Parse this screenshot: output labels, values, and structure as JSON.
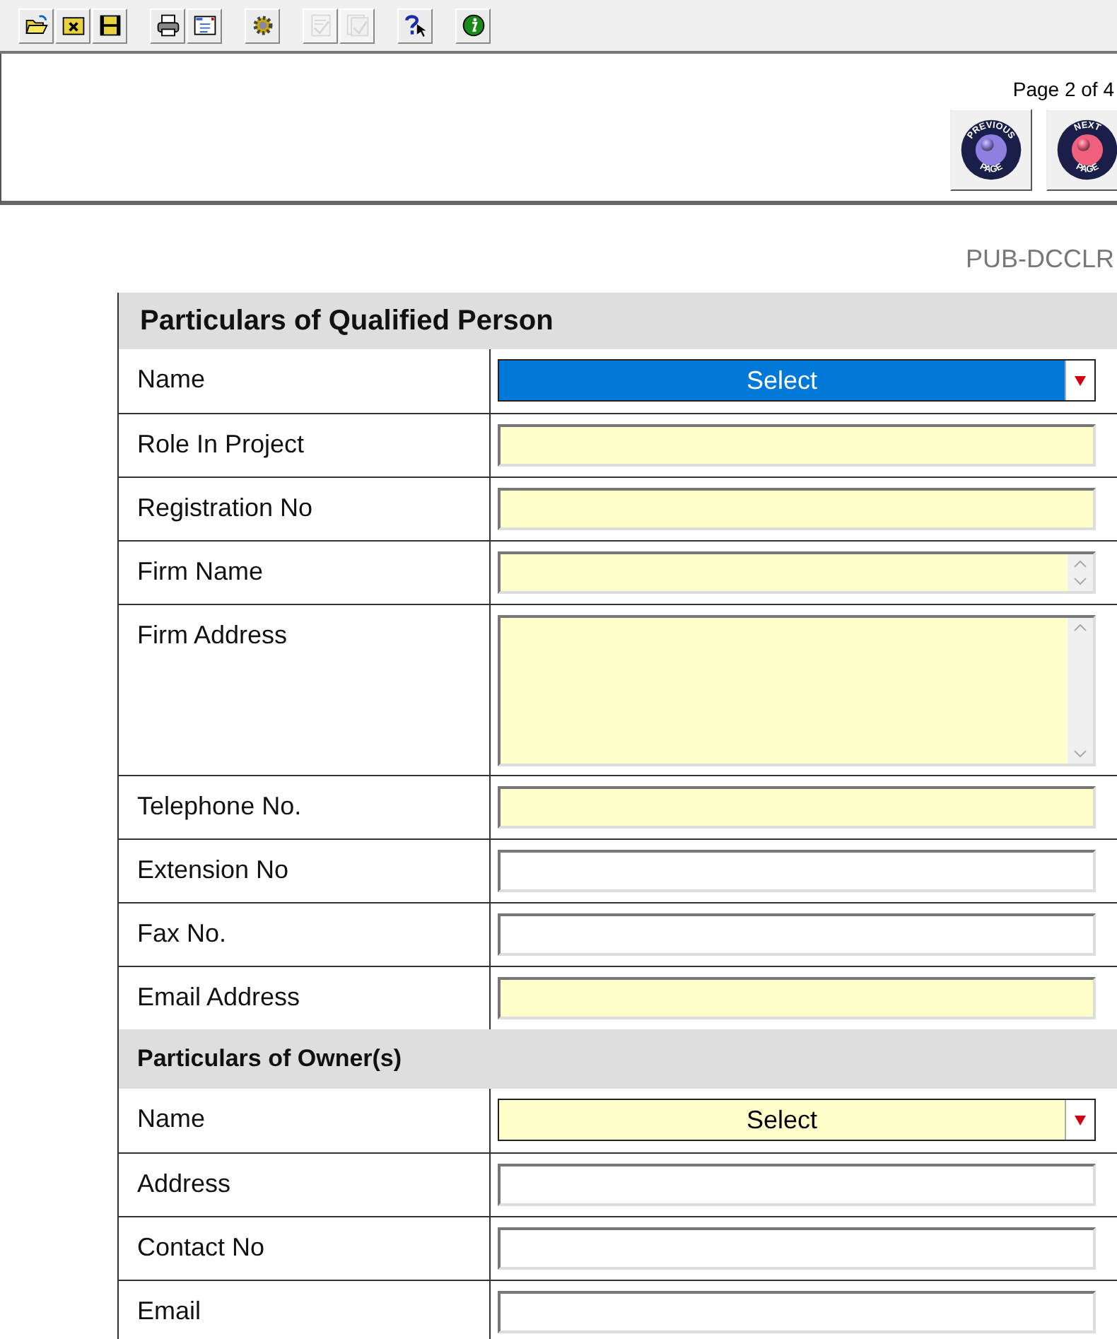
{
  "toolbar": [
    {
      "kind": "open",
      "disabled": false
    },
    {
      "kind": "close",
      "disabled": false
    },
    {
      "kind": "save",
      "disabled": false
    },
    {
      "kind": "print",
      "disabled": false
    },
    {
      "kind": "form",
      "disabled": false
    },
    {
      "kind": "gear",
      "disabled": false
    },
    {
      "kind": "spell",
      "disabled": true
    },
    {
      "kind": "spell-all",
      "disabled": true
    },
    {
      "kind": "help",
      "disabled": false
    },
    {
      "kind": "info",
      "disabled": false
    }
  ],
  "page_indicator": "Page 2 of 4",
  "nav_buttons": [
    {
      "top": "PREVIOUS",
      "bottom": "PAGE",
      "color": "#8f7fe0"
    },
    {
      "top": "NEXT",
      "bottom": "PAGE",
      "color": "#f0607e"
    }
  ],
  "form_code": "PUB-DCCLR",
  "sections": [
    {
      "title": "Particulars of Qualified Person",
      "rows": [
        {
          "label": "Name",
          "field": {
            "kind": "select",
            "value": "Select",
            "highlighted": false,
            "focused": true
          }
        },
        {
          "label": "Role In Project",
          "field": {
            "kind": "text",
            "highlighted": true
          }
        },
        {
          "label": "Registration No",
          "field": {
            "kind": "text",
            "highlighted": true
          }
        },
        {
          "label": "Firm Name",
          "field": {
            "kind": "textbox",
            "highlighted": true
          }
        },
        {
          "label": "Firm Address",
          "field": {
            "kind": "textarea",
            "highlighted": true
          }
        },
        {
          "label": "Telephone No.",
          "field": {
            "kind": "text",
            "highlighted": true
          }
        },
        {
          "label": "Extension No",
          "field": {
            "kind": "text",
            "highlighted": false
          }
        },
        {
          "label": "Fax No.",
          "field": {
            "kind": "text",
            "highlighted": false
          }
        },
        {
          "label": "Email Address",
          "field": {
            "kind": "text",
            "highlighted": true
          }
        }
      ]
    },
    {
      "title": "Particulars of Owner(s)",
      "rows": [
        {
          "label": "Name",
          "field": {
            "kind": "select",
            "value": "Select",
            "highlighted": true,
            "focused": false
          }
        },
        {
          "label": "Address",
          "field": {
            "kind": "text",
            "highlighted": false
          }
        },
        {
          "label": "Contact No",
          "field": {
            "kind": "text",
            "highlighted": false
          }
        },
        {
          "label": "Email",
          "field": {
            "kind": "text",
            "highlighted": false
          }
        }
      ]
    }
  ]
}
